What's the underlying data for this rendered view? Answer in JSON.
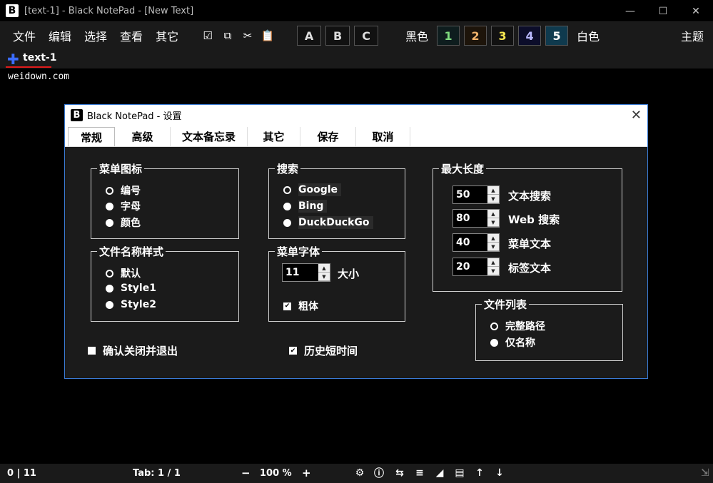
{
  "window": {
    "title": "[text-1] - Black NotePad - [New Text]",
    "logo": "B",
    "controls": [
      "minimize-icon",
      "maximize-icon",
      "close-icon"
    ]
  },
  "menu": {
    "items": [
      "文件",
      "编辑",
      "选择",
      "查看",
      "其它"
    ],
    "tools": [
      "checkbox-icon",
      "copy-icon",
      "cut-icon",
      "paste-icon"
    ],
    "abc": [
      "A",
      "B",
      "C"
    ],
    "black_label": "黑色",
    "numbers": [
      {
        "label": "1",
        "color": "#7fdc7f",
        "bg": "#0e1d1e"
      },
      {
        "label": "2",
        "color": "#f2b36b",
        "bg": "#1d140a"
      },
      {
        "label": "3",
        "color": "#f5e64f",
        "bg": "#111"
      },
      {
        "label": "4",
        "color": "#b9b9ff",
        "bg": "#0c0d2a"
      },
      {
        "label": "5",
        "color": "#ffffff",
        "bg": "#0f3a4e"
      }
    ],
    "white_label": "白色",
    "theme_label": "主题"
  },
  "tab": {
    "label": "text-1"
  },
  "editor": {
    "text": "weidown.com"
  },
  "status": {
    "position": "0 | 11",
    "tab": "Tab: 1 / 1",
    "zoom_minus": "−",
    "zoom": "100 %",
    "zoom_plus": "+",
    "icons": [
      "settings-icon",
      "info-icon",
      "swap-icon",
      "add-list-icon",
      "contrast-icon",
      "word-wrap-icon",
      "font-increase-icon",
      "font-decrease-icon"
    ]
  },
  "dialog": {
    "logo": "B",
    "title": "Black NotePad - 设置",
    "tabs": [
      "常规",
      "高级",
      "文本备忘录",
      "其它",
      "保存",
      "取消"
    ],
    "menu_icon": {
      "title": "菜单图标",
      "options": [
        "编号",
        "字母",
        "颜色"
      ]
    },
    "filename_style": {
      "title": "文件名称样式",
      "options": [
        "默认",
        "Style1",
        "Style2"
      ]
    },
    "search": {
      "title": "搜索",
      "options": [
        "Google",
        "Bing",
        "DuckDuckGo"
      ]
    },
    "menu_font": {
      "title": "菜单字体",
      "size_value": "11",
      "size_label": "大小",
      "bold_label": "粗体"
    },
    "max_length": {
      "title": "最大长度",
      "rows": [
        {
          "value": "50",
          "label": "文本搜索"
        },
        {
          "value": "80",
          "label": "Web 搜索"
        },
        {
          "value": "40",
          "label": "菜单文本"
        },
        {
          "value": "20",
          "label": "标签文本"
        }
      ]
    },
    "file_list": {
      "title": "文件列表",
      "options": [
        "完整路径",
        "仅名称"
      ]
    },
    "confirm_close": "确认关闭并退出",
    "short_history": "历史短时间"
  }
}
